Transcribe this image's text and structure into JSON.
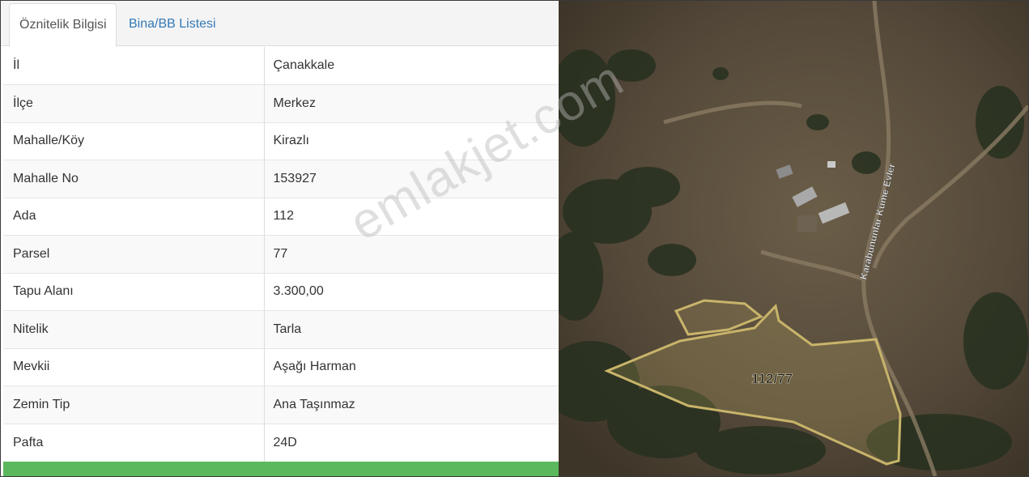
{
  "tabs": {
    "active_label": "Öznitelik Bilgisi",
    "inactive_label": "Bina/BB Listesi"
  },
  "attributes": [
    {
      "key": "İl",
      "value": "Çanakkale"
    },
    {
      "key": "İlçe",
      "value": "Merkez"
    },
    {
      "key": "Mahalle/Köy",
      "value": "Kirazlı"
    },
    {
      "key": "Mahalle No",
      "value": "153927"
    },
    {
      "key": "Ada",
      "value": "112"
    },
    {
      "key": "Parsel",
      "value": "77"
    },
    {
      "key": "Tapu Alanı",
      "value": "3.300,00"
    },
    {
      "key": "Nitelik",
      "value": "Tarla"
    },
    {
      "key": "Mevkii",
      "value": "Aşağı Harman"
    },
    {
      "key": "Zemin Tip",
      "value": "Ana Taşınmaz"
    },
    {
      "key": "Pafta",
      "value": "24D"
    }
  ],
  "map": {
    "parcel_label": "112/77",
    "road_label": "Karabununlar Küme Evler",
    "boundary_color": "#c8b46a",
    "accent_bar_color": "#5cb85c"
  },
  "watermark": "emlakjet.com"
}
